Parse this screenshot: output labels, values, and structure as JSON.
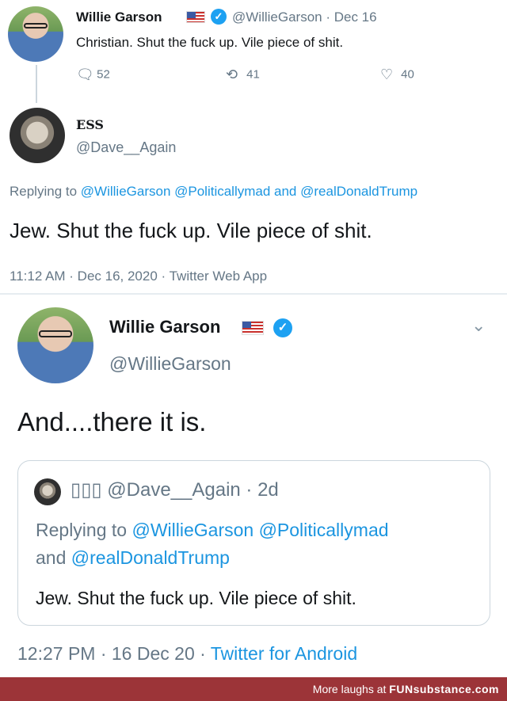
{
  "tweet1": {
    "name": "Willie Garson",
    "handle_date": "@WillieGarson · Dec 16",
    "text": "Christian. Shut the fuck up. Vile piece of shit.",
    "replies": "52",
    "retweets": "41",
    "likes": "40"
  },
  "tweet2": {
    "name": "ESS",
    "handle": "@Dave__Again",
    "replying_prefix": "Replying to ",
    "replying_to": "@WillieGarson @Politicallymad and @realDonaldTrump",
    "text": "Jew. Shut the fuck up. Vile piece of shit.",
    "meta": "11:12 AM · Dec 16, 2020 · Twitter Web App"
  },
  "tweet3": {
    "name": "Willie Garson",
    "handle": "@WillieGarson",
    "text": "And....there it is.",
    "quote": {
      "name_handle_date": "▯▯▯ @Dave__Again · 2d",
      "replying_prefix": "Replying to ",
      "replying_line1": "@WillieGarson @Politicallymad",
      "replying_and": "and ",
      "replying_line2": "@realDonaldTrump",
      "text": "Jew. Shut the fuck up. Vile piece of shit."
    },
    "time_date": "12:27 PM · 16 Dec 20 · ",
    "source": "Twitter for Android"
  },
  "banner": {
    "prefix": "More laughs at ",
    "brand": "FUNsubstance.com"
  },
  "icons": {
    "reply": "speech-bubble",
    "retweet": "retweet-arrows",
    "like": "heart",
    "verified": "check-badge",
    "flag": "us-flag",
    "chevron": "chevron-down"
  },
  "colors": {
    "link": "#1b95e0",
    "verified": "#1da1f2",
    "banner": "#9c3438"
  }
}
